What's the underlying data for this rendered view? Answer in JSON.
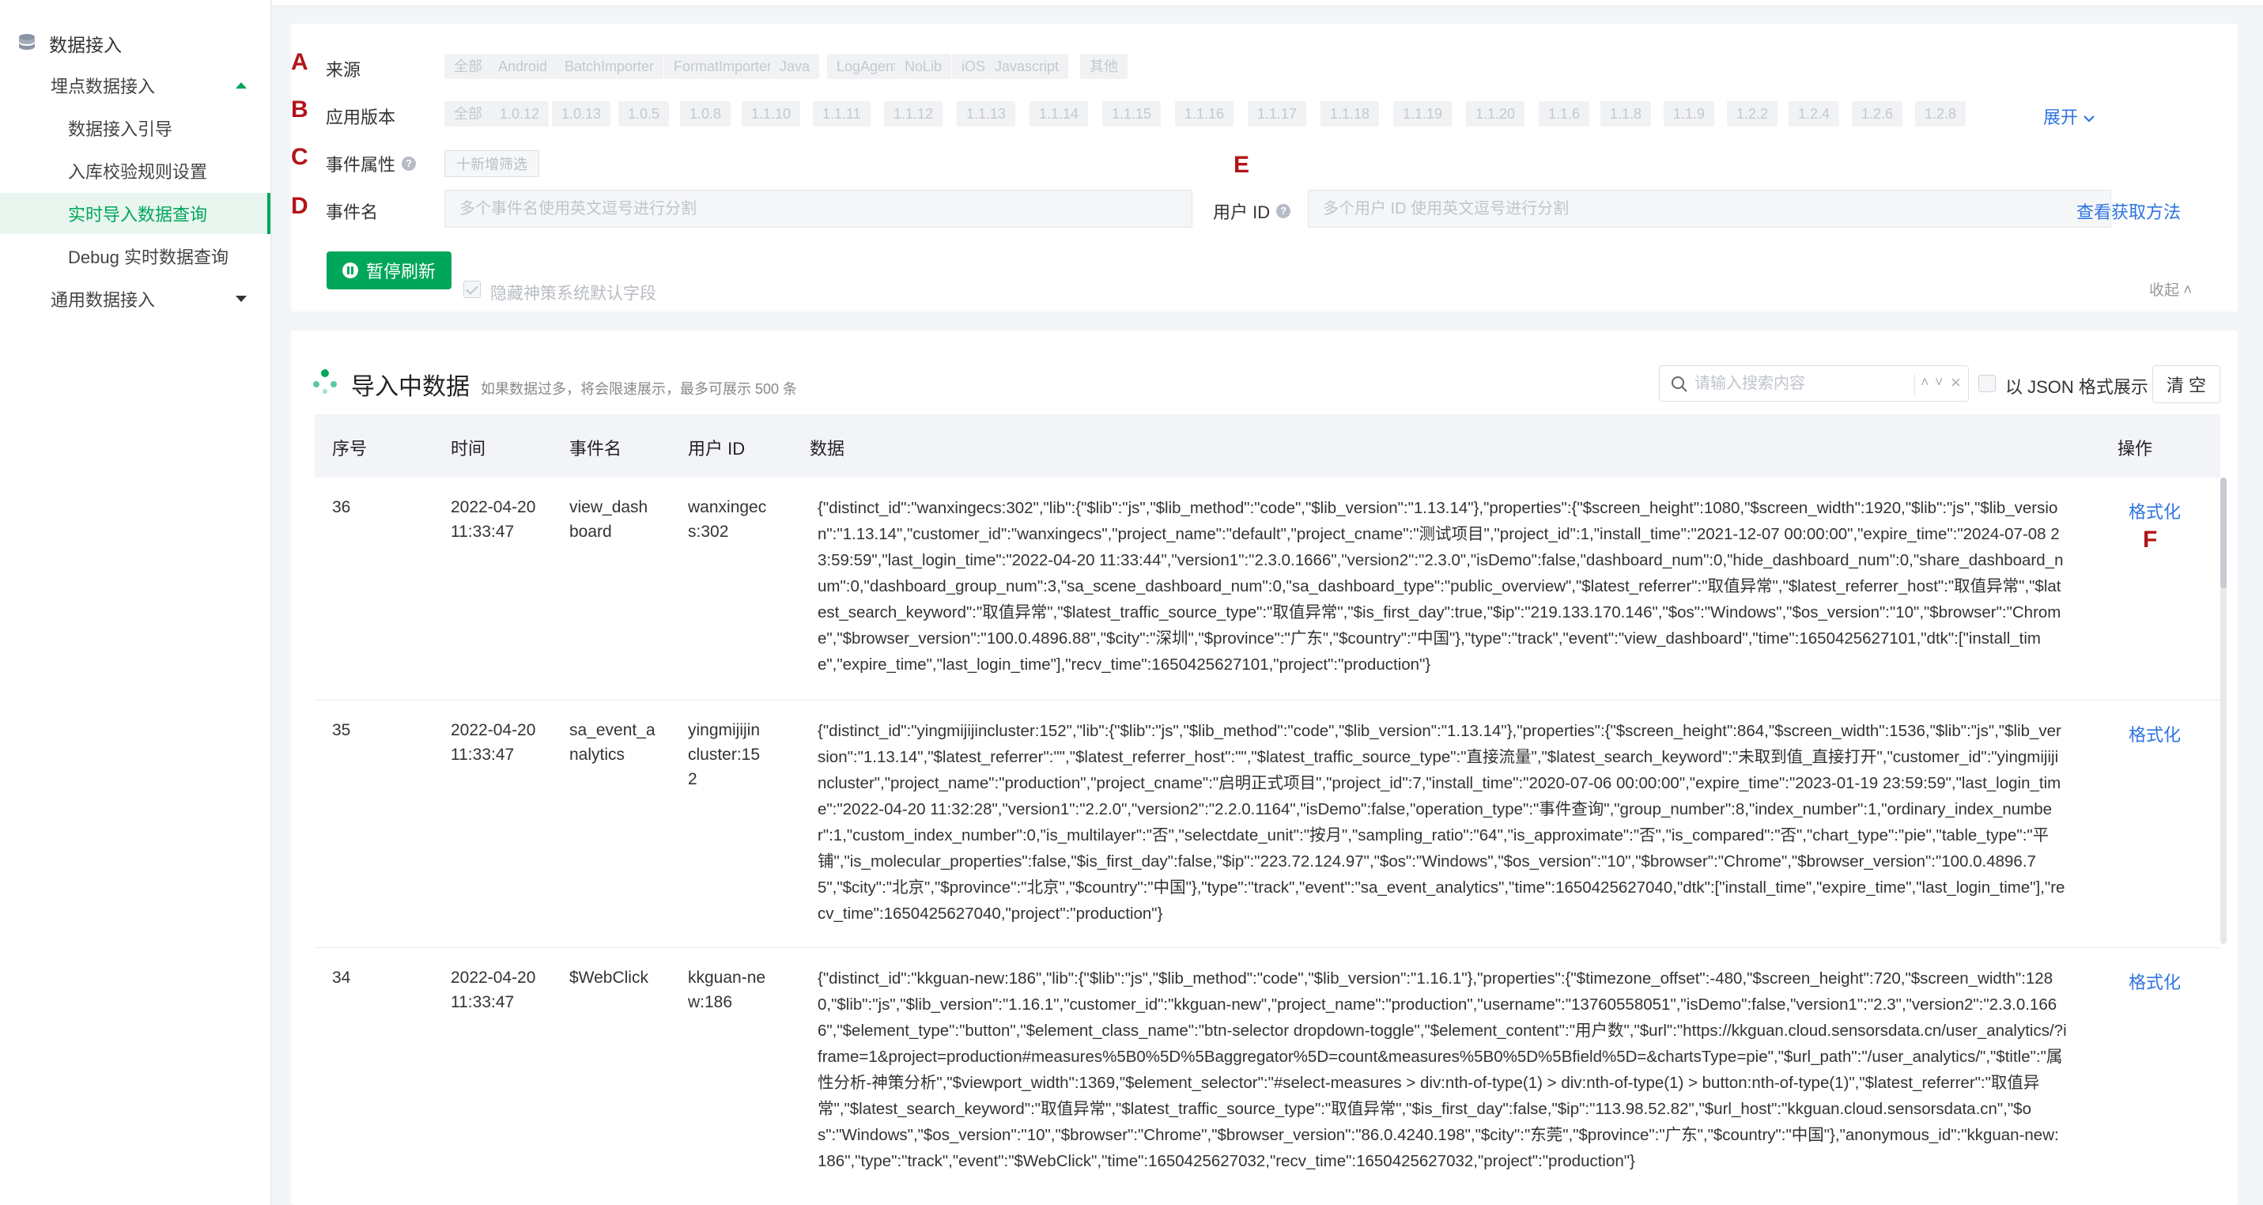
{
  "sidebar": {
    "root_label": "数据接入",
    "items": [
      {
        "label": "埋点数据接入",
        "level": 1,
        "caret": "up"
      },
      {
        "label": "数据接入引导",
        "level": 2
      },
      {
        "label": "入库校验规则设置",
        "level": 2
      },
      {
        "label": "实时导入数据查询",
        "level": 2,
        "active": true
      },
      {
        "label": "Debug 实时数据查询",
        "level": 2
      },
      {
        "label": "通用数据接入",
        "level": 1,
        "caret": "down"
      }
    ]
  },
  "markers": {
    "a": "A",
    "b": "B",
    "c": "C",
    "d": "D",
    "e": "E",
    "f": "F"
  },
  "filters": {
    "source_label": "来源",
    "sources": [
      "全部",
      "Android",
      "BatchImporter",
      "FormatImporter",
      "Java",
      "LogAgent",
      "NoLib",
      "iOS",
      "Javascript",
      "其他"
    ],
    "version_label": "应用版本",
    "versions": [
      "全部",
      "1.0.12",
      "1.0.13",
      "1.0.5",
      "1.0.8",
      "1.1.10",
      "1.1.11",
      "1.1.12",
      "1.1.13",
      "1.1.14",
      "1.1.15",
      "1.1.16",
      "1.1.17",
      "1.1.18",
      "1.1.19",
      "1.1.20",
      "1.1.6",
      "1.1.8",
      "1.1.9",
      "1.2.2",
      "1.2.4",
      "1.2.6",
      "1.2.8"
    ],
    "expand_label": "展开",
    "event_attr_label": "事件属性",
    "add_filter_label": "十新增筛选",
    "event_name_label": "事件名",
    "event_name_placeholder": "多个事件名使用英文逗号进行分割",
    "user_id_label": "用户 ID",
    "user_id_placeholder": "多个用户 ID 使用英文逗号进行分割",
    "how_to_get_label": "查看获取方法",
    "pause_label": "暂停刷新",
    "hide_fields_label": "隐藏神策系统默认字段",
    "collapse_label": "收起 ˄"
  },
  "data_panel": {
    "title": "导入中数据",
    "subtitle": "如果数据过多，将会限速展示，最多可展示 500 条",
    "search_placeholder": "请输入搜索内容",
    "search_up": "˄",
    "search_down": "˅",
    "search_clear": "×",
    "json_label": "以 JSON 格式展示",
    "clear_label": "清 空",
    "columns": [
      "序号",
      "时间",
      "事件名",
      "用户 ID",
      "数据",
      "操作"
    ],
    "rows": [
      {
        "no": "36",
        "time": "2022-04-20 11:33:47",
        "event": "view_dashboard",
        "user": "wanxingecs:302",
        "data": "{\"distinct_id\":\"wanxingecs:302\",\"lib\":{\"$lib\":\"js\",\"$lib_method\":\"code\",\"$lib_version\":\"1.13.14\"},\"properties\":{\"$screen_height\":1080,\"$screen_width\":1920,\"$lib\":\"js\",\"$lib_version\":\"1.13.14\",\"customer_id\":\"wanxingecs\",\"project_name\":\"default\",\"project_cname\":\"测试项目\",\"project_id\":1,\"install_time\":\"2021-12-07 00:00:00\",\"expire_time\":\"2024-07-08 23:59:59\",\"last_login_time\":\"2022-04-20 11:33:44\",\"version1\":\"2.3.0.1666\",\"version2\":\"2.3.0\",\"isDemo\":false,\"dashboard_num\":0,\"hide_dashboard_num\":0,\"share_dashboard_num\":0,\"dashboard_group_num\":3,\"sa_scene_dashboard_num\":0,\"sa_dashboard_type\":\"public_overview\",\"$latest_referrer\":\"取值异常\",\"$latest_referrer_host\":\"取值异常\",\"$latest_search_keyword\":\"取值异常\",\"$latest_traffic_source_type\":\"取值异常\",\"$is_first_day\":true,\"$ip\":\"219.133.170.146\",\"$os\":\"Windows\",\"$os_version\":\"10\",\"$browser\":\"Chrome\",\"$browser_version\":\"100.0.4896.88\",\"$city\":\"深圳\",\"$province\":\"广东\",\"$country\":\"中国\"},\"type\":\"track\",\"event\":\"view_dashboard\",\"time\":1650425627101,\"dtk\":[\"install_time\",\"expire_time\",\"last_login_time\"],\"recv_time\":1650425627101,\"project\":\"production\"}",
        "action": "格式化"
      },
      {
        "no": "35",
        "time": "2022-04-20 11:33:47",
        "event": "sa_event_analytics",
        "user": "yingmijijincluster:152",
        "data": "{\"distinct_id\":\"yingmijijincluster:152\",\"lib\":{\"$lib\":\"js\",\"$lib_method\":\"code\",\"$lib_version\":\"1.13.14\"},\"properties\":{\"$screen_height\":864,\"$screen_width\":1536,\"$lib\":\"js\",\"$lib_version\":\"1.13.14\",\"$latest_referrer\":\"\",\"$latest_referrer_host\":\"\",\"$latest_traffic_source_type\":\"直接流量\",\"$latest_search_keyword\":\"未取到值_直接打开\",\"customer_id\":\"yingmijijincluster\",\"project_name\":\"production\",\"project_cname\":\"启明正式项目\",\"project_id\":7,\"install_time\":\"2020-07-06 00:00:00\",\"expire_time\":\"2023-01-19 23:59:59\",\"last_login_time\":\"2022-04-20 11:32:28\",\"version1\":\"2.2.0\",\"version2\":\"2.2.0.1164\",\"isDemo\":false,\"operation_type\":\"事件查询\",\"group_number\":8,\"index_number\":1,\"ordinary_index_number\":1,\"custom_index_number\":0,\"is_multilayer\":\"否\",\"selectdate_unit\":\"按月\",\"sampling_ratio\":\"64\",\"is_approximate\":\"否\",\"is_compared\":\"否\",\"chart_type\":\"pie\",\"table_type\":\"平铺\",\"is_molecular_properties\":false,\"$is_first_day\":false,\"$ip\":\"223.72.124.97\",\"$os\":\"Windows\",\"$os_version\":\"10\",\"$browser\":\"Chrome\",\"$browser_version\":\"100.0.4896.75\",\"$city\":\"北京\",\"$province\":\"北京\",\"$country\":\"中国\"},\"type\":\"track\",\"event\":\"sa_event_analytics\",\"time\":1650425627040,\"dtk\":[\"install_time\",\"expire_time\",\"last_login_time\"],\"recv_time\":1650425627040,\"project\":\"production\"}",
        "action": "格式化"
      },
      {
        "no": "34",
        "time": "2022-04-20 11:33:47",
        "event": "$WebClick",
        "user": "kkguan-new:186",
        "data": "{\"distinct_id\":\"kkguan-new:186\",\"lib\":{\"$lib\":\"js\",\"$lib_method\":\"code\",\"$lib_version\":\"1.16.1\"},\"properties\":{\"$timezone_offset\":-480,\"$screen_height\":720,\"$screen_width\":1280,\"$lib\":\"js\",\"$lib_version\":\"1.16.1\",\"customer_id\":\"kkguan-new\",\"project_name\":\"production\",\"username\":\"13760558051\",\"isDemo\":false,\"version1\":\"2.3\",\"version2\":\"2.3.0.1666\",\"$element_type\":\"button\",\"$element_class_name\":\"btn-selector dropdown-toggle\",\"$element_content\":\"用户数\",\"$url\":\"https://kkguan.cloud.sensorsdata.cn/user_analytics/?iframe=1&project=production#measures%5B0%5D%5Baggregator%5D=count&measures%5B0%5D%5Bfield%5D=&chartsType=pie\",\"$url_path\":\"/user_analytics/\",\"$title\":\"属性分析-神策分析\",\"$viewport_width\":1369,\"$element_selector\":\"#select-measures > div:nth-of-type(1) > div:nth-of-type(1) > button:nth-of-type(1)\",\"$latest_referrer\":\"取值异常\",\"$latest_search_keyword\":\"取值异常\",\"$latest_traffic_source_type\":\"取值异常\",\"$is_first_day\":false,\"$ip\":\"113.98.52.82\",\"$url_host\":\"kkguan.cloud.sensorsdata.cn\",\"$os\":\"Windows\",\"$os_version\":\"10\",\"$browser\":\"Chrome\",\"$browser_version\":\"86.0.4240.198\",\"$city\":\"东莞\",\"$province\":\"广东\",\"$country\":\"中国\"},\"anonymous_id\":\"kkguan-new:186\",\"type\":\"track\",\"event\":\"$WebClick\",\"time\":1650425627032,\"recv_time\":1650425627032,\"project\":\"production\"}",
        "action": "格式化"
      }
    ]
  },
  "colors": {
    "accent": "#00a65a",
    "link": "#2f74e0",
    "marker": "#b3141a"
  }
}
